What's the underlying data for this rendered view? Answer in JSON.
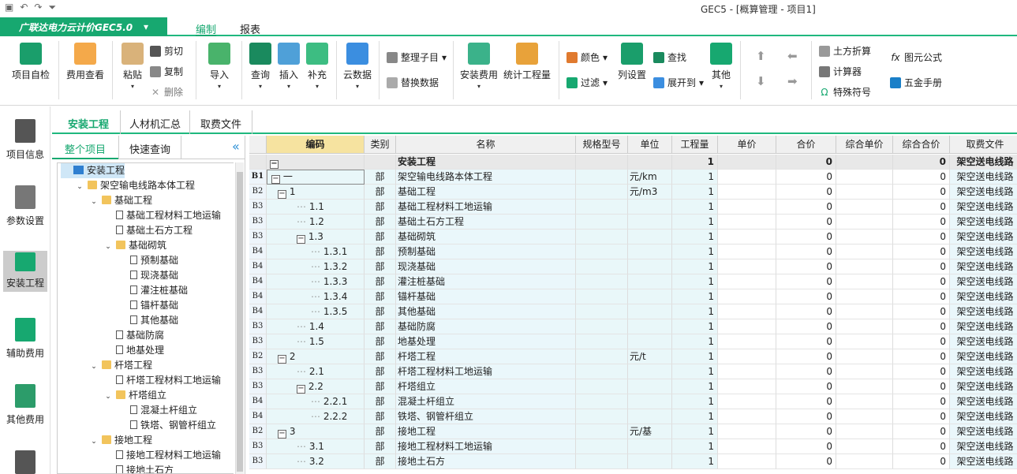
{
  "window": {
    "title": "GEC5 - [概算管理 - 项目1]"
  },
  "product": {
    "name": "广联达电力云计价GEC5.0",
    "dropdown": "▾"
  },
  "ribbon_tabs": [
    "编制",
    "报表"
  ],
  "ribbon": {
    "project_check": "项目自检",
    "fee_view": "费用查看",
    "paste": "粘贴",
    "cut": "剪切",
    "copy": "复制",
    "delete": "删除",
    "import": "导入",
    "query": "查询",
    "insert": "插入",
    "supplement": "补充",
    "cloud_data": "云数据",
    "organize": "整理子目",
    "replace": "替换数据",
    "install_fee": "安装费用",
    "stat_quantity": "统计工程量",
    "color": "颜色",
    "filter": "过滤",
    "col_settings": "列设置",
    "find": "查找",
    "expand_to": "展开到",
    "other": "其他",
    "earth_calc": "土方折算",
    "calculator": "计算器",
    "special_symbols": "特殊符号",
    "element_formula": "图元公式",
    "hardware_manual": "五金手册"
  },
  "sidebar": [
    "项目信息",
    "参数设置",
    "安装工程",
    "辅助费用",
    "其他费用"
  ],
  "main_tabs": [
    "安装工程",
    "人材机汇总",
    "取费文件"
  ],
  "tree_tabs": [
    "整个项目",
    "快速查询"
  ],
  "tree": [
    {
      "label": "安装工程",
      "toggle": "",
      "icon": "root"
    },
    {
      "label": "架空输电线路本体工程",
      "toggle": "⌄",
      "icon": "folder"
    },
    {
      "label": "基础工程",
      "toggle": "⌄",
      "icon": "folder"
    },
    {
      "label": "基础工程材料工地运输",
      "toggle": "",
      "icon": "doc"
    },
    {
      "label": "基础土石方工程",
      "toggle": "",
      "icon": "doc"
    },
    {
      "label": "基础砌筑",
      "toggle": "⌄",
      "icon": "folder"
    },
    {
      "label": "预制基础",
      "toggle": "",
      "icon": "doc"
    },
    {
      "label": "现浇基础",
      "toggle": "",
      "icon": "doc"
    },
    {
      "label": "灌注桩基础",
      "toggle": "",
      "icon": "doc"
    },
    {
      "label": "锚杆基础",
      "toggle": "",
      "icon": "doc"
    },
    {
      "label": "其他基础",
      "toggle": "",
      "icon": "doc"
    },
    {
      "label": "基础防腐",
      "toggle": "",
      "icon": "doc"
    },
    {
      "label": "地基处理",
      "toggle": "",
      "icon": "doc"
    },
    {
      "label": "杆塔工程",
      "toggle": "⌄",
      "icon": "folder"
    },
    {
      "label": "杆塔工程材料工地运输",
      "toggle": "",
      "icon": "doc"
    },
    {
      "label": "杆塔组立",
      "toggle": "⌄",
      "icon": "folder"
    },
    {
      "label": "混凝土杆组立",
      "toggle": "",
      "icon": "doc"
    },
    {
      "label": "铁塔、钢管杆组立",
      "toggle": "",
      "icon": "doc"
    },
    {
      "label": "接地工程",
      "toggle": "⌄",
      "icon": "folder"
    },
    {
      "label": "接地工程材料工地运输",
      "toggle": "",
      "icon": "doc"
    },
    {
      "label": "接地土石方",
      "toggle": "",
      "icon": "doc"
    }
  ],
  "grid": {
    "headers": [
      "编码",
      "类别",
      "名称",
      "规格型号",
      "单位",
      "工程量",
      "单价",
      "合价",
      "综合单价",
      "综合合价",
      "取费文件"
    ],
    "summary": {
      "box": "−",
      "name": "安装工程",
      "qty": "1",
      "total": "0",
      "comp_total": "0",
      "fee": "架空送电线路"
    },
    "rows": [
      {
        "lvl": "B1",
        "box": "−",
        "code": "一",
        "type": "部",
        "name": "架空输电线路本体工程",
        "unit": "元/km",
        "qty": "1",
        "total": "0",
        "comp_total": "0",
        "fee": "架空送电线路"
      },
      {
        "lvl": "B2",
        "box": "−",
        "code": "1",
        "type": "部",
        "name": "基础工程",
        "unit": "元/m3",
        "qty": "1",
        "total": "0",
        "comp_total": "0",
        "fee": "架空送电线路"
      },
      {
        "lvl": "B3",
        "box": "",
        "code": "1.1",
        "type": "部",
        "name": "基础工程材料工地运输",
        "unit": "",
        "qty": "1",
        "total": "0",
        "comp_total": "0",
        "fee": "架空送电线路"
      },
      {
        "lvl": "B3",
        "box": "",
        "code": "1.2",
        "type": "部",
        "name": "基础土石方工程",
        "unit": "",
        "qty": "1",
        "total": "0",
        "comp_total": "0",
        "fee": "架空送电线路"
      },
      {
        "lvl": "B3",
        "box": "−",
        "code": "1.3",
        "type": "部",
        "name": "基础砌筑",
        "unit": "",
        "qty": "1",
        "total": "0",
        "comp_total": "0",
        "fee": "架空送电线路"
      },
      {
        "lvl": "B4",
        "box": "",
        "code": "1.3.1",
        "type": "部",
        "name": "预制基础",
        "unit": "",
        "qty": "1",
        "total": "0",
        "comp_total": "0",
        "fee": "架空送电线路"
      },
      {
        "lvl": "B4",
        "box": "",
        "code": "1.3.2",
        "type": "部",
        "name": "现浇基础",
        "unit": "",
        "qty": "1",
        "total": "0",
        "comp_total": "0",
        "fee": "架空送电线路"
      },
      {
        "lvl": "B4",
        "box": "",
        "code": "1.3.3",
        "type": "部",
        "name": "灌注桩基础",
        "unit": "",
        "qty": "1",
        "total": "0",
        "comp_total": "0",
        "fee": "架空送电线路"
      },
      {
        "lvl": "B4",
        "box": "",
        "code": "1.3.4",
        "type": "部",
        "name": "锚杆基础",
        "unit": "",
        "qty": "1",
        "total": "0",
        "comp_total": "0",
        "fee": "架空送电线路"
      },
      {
        "lvl": "B4",
        "box": "",
        "code": "1.3.5",
        "type": "部",
        "name": "其他基础",
        "unit": "",
        "qty": "1",
        "total": "0",
        "comp_total": "0",
        "fee": "架空送电线路"
      },
      {
        "lvl": "B3",
        "box": "",
        "code": "1.4",
        "type": "部",
        "name": "基础防腐",
        "unit": "",
        "qty": "1",
        "total": "0",
        "comp_total": "0",
        "fee": "架空送电线路"
      },
      {
        "lvl": "B3",
        "box": "",
        "code": "1.5",
        "type": "部",
        "name": "地基处理",
        "unit": "",
        "qty": "1",
        "total": "0",
        "comp_total": "0",
        "fee": "架空送电线路"
      },
      {
        "lvl": "B2",
        "box": "−",
        "code": "2",
        "type": "部",
        "name": "杆塔工程",
        "unit": "元/t",
        "qty": "1",
        "total": "0",
        "comp_total": "0",
        "fee": "架空送电线路"
      },
      {
        "lvl": "B3",
        "box": "",
        "code": "2.1",
        "type": "部",
        "name": "杆塔工程材料工地运输",
        "unit": "",
        "qty": "1",
        "total": "0",
        "comp_total": "0",
        "fee": "架空送电线路"
      },
      {
        "lvl": "B3",
        "box": "−",
        "code": "2.2",
        "type": "部",
        "name": "杆塔组立",
        "unit": "",
        "qty": "1",
        "total": "0",
        "comp_total": "0",
        "fee": "架空送电线路"
      },
      {
        "lvl": "B4",
        "box": "",
        "code": "2.2.1",
        "type": "部",
        "name": "混凝土杆组立",
        "unit": "",
        "qty": "1",
        "total": "0",
        "comp_total": "0",
        "fee": "架空送电线路"
      },
      {
        "lvl": "B4",
        "box": "",
        "code": "2.2.2",
        "type": "部",
        "name": "铁塔、钢管杆组立",
        "unit": "",
        "qty": "1",
        "total": "0",
        "comp_total": "0",
        "fee": "架空送电线路"
      },
      {
        "lvl": "B2",
        "box": "−",
        "code": "3",
        "type": "部",
        "name": "接地工程",
        "unit": "元/基",
        "qty": "1",
        "total": "0",
        "comp_total": "0",
        "fee": "架空送电线路"
      },
      {
        "lvl": "B3",
        "box": "",
        "code": "3.1",
        "type": "部",
        "name": "接地工程材料工地运输",
        "unit": "",
        "qty": "1",
        "total": "0",
        "comp_total": "0",
        "fee": "架空送电线路"
      },
      {
        "lvl": "B3",
        "box": "",
        "code": "3.2",
        "type": "部",
        "name": "接地土石方",
        "unit": "",
        "qty": "1",
        "total": "0",
        "comp_total": "0",
        "fee": "架空送电线路"
      }
    ]
  },
  "colors": {
    "accent": "#17a870",
    "header_code": "#f6e3a0",
    "selected": "#cfe7f7"
  }
}
